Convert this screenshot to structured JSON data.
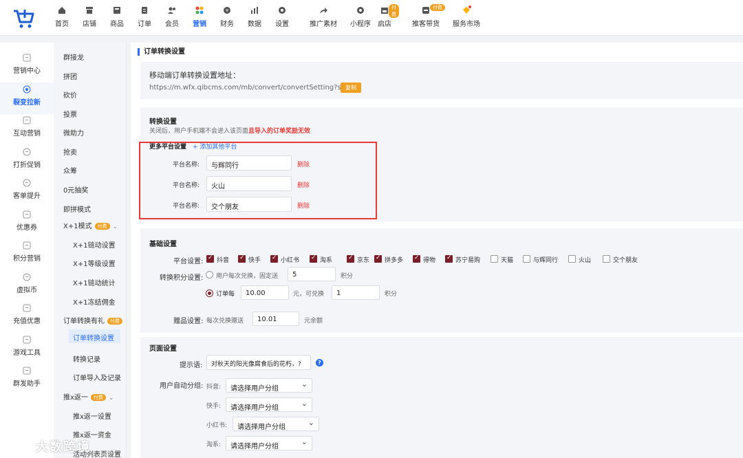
{
  "topnav": {
    "items": [
      {
        "label": "首页",
        "icon": "home-icon"
      },
      {
        "label": "店铺",
        "icon": "store-icon"
      },
      {
        "label": "商品",
        "icon": "goods-icon"
      },
      {
        "label": "订单",
        "icon": "order-icon"
      },
      {
        "label": "会员",
        "icon": "member-icon"
      },
      {
        "label": "营销",
        "icon": "marketing-icon",
        "active": true
      },
      {
        "label": "财务",
        "icon": "finance-icon"
      },
      {
        "label": "数据",
        "icon": "data-icon"
      },
      {
        "label": "设置",
        "icon": "gear-icon"
      },
      {
        "label": "推广素材",
        "icon": "share-icon"
      },
      {
        "label": "小程序",
        "icon": "miniapp-icon"
      },
      {
        "label": "启店",
        "icon": "shop-open-icon",
        "badge": "付费"
      },
      {
        "label": "推客带货",
        "icon": "promoter-icon",
        "badge": "付费"
      },
      {
        "label": "服务市场",
        "icon": "service-market-icon"
      }
    ]
  },
  "rail": {
    "items": [
      {
        "label": "营销中心",
        "icon": "chart-icon"
      },
      {
        "label": "裂变拉新",
        "icon": "fission-icon",
        "active": true
      },
      {
        "label": "互动营销",
        "icon": "send-icon"
      },
      {
        "label": "打折促销",
        "icon": "discount-icon"
      },
      {
        "label": "客单提升",
        "icon": "yuan-icon"
      },
      {
        "label": "优惠券",
        "icon": "coupon-icon"
      },
      {
        "label": "积分营销",
        "icon": "points-icon"
      },
      {
        "label": "虚拟币",
        "icon": "coin-icon"
      },
      {
        "label": "充值优惠",
        "icon": "recharge-icon"
      },
      {
        "label": "游戏工具",
        "icon": "game-icon"
      },
      {
        "label": "群发助手",
        "icon": "mail-icon"
      }
    ]
  },
  "submenu": {
    "items": [
      {
        "label": "群接龙"
      },
      {
        "label": "拼团"
      },
      {
        "label": "砍价"
      },
      {
        "label": "投票"
      },
      {
        "label": "微助力"
      },
      {
        "label": "抢卖"
      },
      {
        "label": "众筹"
      },
      {
        "label": "0元抽奖"
      },
      {
        "label": "即拼模式"
      },
      {
        "label": "X+1模式",
        "badge": "付费",
        "chevron": "⌄"
      },
      {
        "label": "X+1链动设置",
        "sub": true
      },
      {
        "label": "X+1等级设置",
        "sub": true
      },
      {
        "label": "X+1链动统计",
        "sub": true
      },
      {
        "label": "X+1冻结佣金",
        "sub": true
      },
      {
        "label": "订单转换有礼",
        "badge": "付费",
        "chevron": "›"
      },
      {
        "label": "订单转换设置",
        "sub": true,
        "active": true
      },
      {
        "label": "转换记录",
        "sub": true
      },
      {
        "label": "订单导入及记录",
        "sub": true
      },
      {
        "label": "推x返一",
        "badge": "付费",
        "chevron": "⌄"
      },
      {
        "label": "推x返一设置",
        "sub": true
      },
      {
        "label": "推x返一资金",
        "sub": true
      },
      {
        "label": "活动列表页设置",
        "sub": true
      }
    ]
  },
  "page": {
    "title": "订单转换设置",
    "mobile_url_label": "移动端订单转换设置地址：",
    "mobile_url": "https://m.wfx.qibcms.com/mb/convert/convertSetting?sid=6",
    "copy_label": "复制",
    "convert": {
      "title": "转换设置",
      "desc_prefix": "关闭后，用户手机端不会进入该页面",
      "desc_warn": "且导入的订单奖励无效",
      "more_platforms_label": "更多平台设置",
      "add_platform_label": "+ 添加其他平台",
      "platform_name_label": "平台名称:",
      "delete_label": "删除",
      "platforms": [
        "与辉同行",
        "火山",
        "交个朋友"
      ]
    },
    "basic": {
      "title": "基础设置",
      "platform_label": "平台设置:",
      "platform_options": [
        {
          "label": "抖音",
          "checked": true
        },
        {
          "label": "快手",
          "checked": true
        },
        {
          "label": "小红书",
          "checked": true
        },
        {
          "label": "淘系",
          "checked": true
        },
        {
          "label": "京东",
          "checked": true
        },
        {
          "label": "拼多多",
          "checked": true
        },
        {
          "label": "得物",
          "checked": true
        },
        {
          "label": "苏宁易购",
          "checked": true
        },
        {
          "label": "天猫",
          "checked": false
        },
        {
          "label": "与辉同行",
          "checked": false
        },
        {
          "label": "火山",
          "checked": false
        },
        {
          "label": "交个朋友",
          "checked": false
        }
      ],
      "points_label": "转换积分设置:",
      "option1_label": "用户每次兑换，固定送",
      "option1_value": "5",
      "points_unit": "积分",
      "option2_prefix": "订单每",
      "option2_amount": "10.00",
      "option2_middle": "元，可兑换",
      "option2_points": "1",
      "gift_label": "赠品设置:",
      "gift_prefix": "每次兑换赠送",
      "gift_value": "10.01",
      "gift_unit": "元余额"
    },
    "page_settings": {
      "title": "页面设置",
      "tip_label": "提示语:",
      "tip_value": "对秋天的阳光像腐食后的花朽，?",
      "group_label": "用户自动分组:",
      "group_placeholder": "请选择用户分组",
      "groups": [
        {
          "platform": "抖音:"
        },
        {
          "platform": "快手:"
        },
        {
          "platform": "小红书:"
        },
        {
          "platform": "淘系:"
        }
      ]
    }
  },
  "watermark": {
    "text": "大数跨境"
  }
}
